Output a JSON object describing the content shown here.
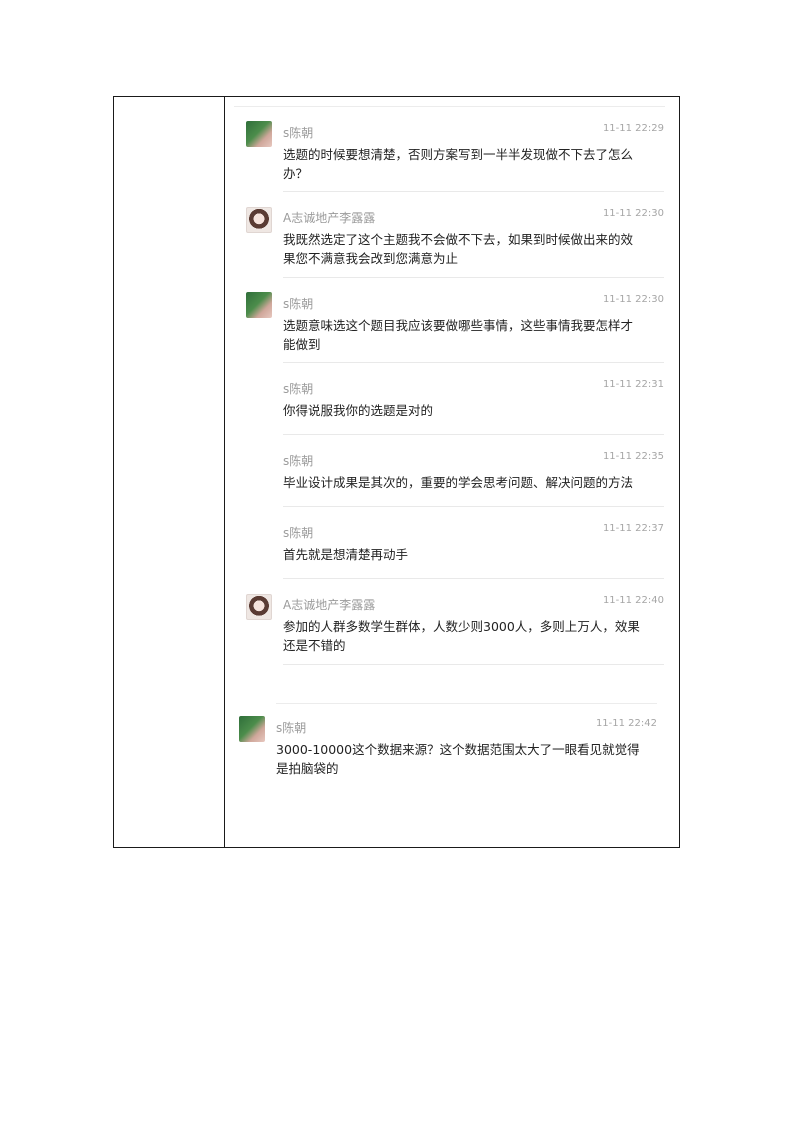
{
  "messages": [
    {
      "name": "s陈朝",
      "time": "11-11 22:29",
      "avatar": "green-avatar",
      "lines": [
        "选题的时候要想清楚，否则方案写到一半半发现做不下去了怎么",
        "办？"
      ]
    },
    {
      "name": "A志诚地产李露露",
      "time": "11-11 22:30",
      "avatar": "girl-avatar",
      "lines": [
        "我既然选定了这个主题我不会做不下去，如果到时候做出来的效",
        "果您不满意我会改到您满意为止"
      ]
    },
    {
      "name": "s陈朝",
      "time": "11-11 22:30",
      "avatar": "green-avatar",
      "lines": [
        "选题意味选这个题目我应该要做哪些事情，这些事情我要怎样才",
        "能做到"
      ]
    },
    {
      "name": "s陈朝",
      "time": "11-11 22:31",
      "avatar": "",
      "lines": [
        "你得说服我你的选题是对的"
      ]
    },
    {
      "name": "s陈朝",
      "time": "11-11 22:35",
      "avatar": "",
      "lines": [
        "毕业设计成果是其次的，重要的学会思考问题、解决问题的方法"
      ]
    },
    {
      "name": "s陈朝",
      "time": "11-11 22:37",
      "avatar": "",
      "lines": [
        "首先就是想清楚再动手"
      ]
    },
    {
      "name": "A志诚地产李露露",
      "time": "11-11 22:40",
      "avatar": "girl-avatar",
      "lines": [
        "参加的人群多数学生群体，人数少则3000人，多则上万人，效果",
        "还是不错的"
      ]
    },
    {
      "name": "s陈朝",
      "time": "11-11 22:42",
      "avatar": "green-avatar",
      "lines": [
        "3000-10000这个数据来源？这个数据范围太大了一眼看见就觉得",
        "是拍脑袋的"
      ]
    }
  ]
}
